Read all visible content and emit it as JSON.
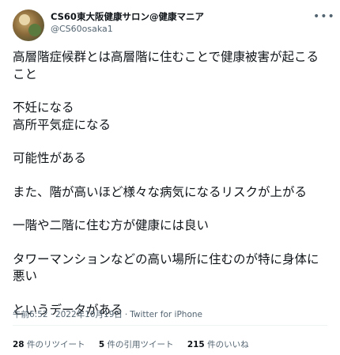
{
  "header": {
    "display_name": "CS60東大阪健康サロン@健康マニア",
    "handle": "@CS60osaka1",
    "more_icon": "ellipsis-icon"
  },
  "tweet": {
    "paragraphs": [
      "高層階症候群とは高層階に住むことで健康被害が起こること",
      "不妊になる\n高所平気症になる",
      "可能性がある",
      "また、階が高いほど様々な病気になるリスクが上がる",
      "一階や二階に住む方が健康には良い",
      "タワーマンションなどの高い場所に住むのが特に身体に悪い",
      "というデータがある"
    ]
  },
  "meta": {
    "time": "午前6:52",
    "date": "2022年10月19日",
    "client": "Twitter for iPhone"
  },
  "stats": {
    "retweets_count": "28",
    "retweets_label": "件のリツイート",
    "quotes_count": "5",
    "quotes_label": "件の引用ツイート",
    "likes_count": "215",
    "likes_label": "件のいいね"
  }
}
